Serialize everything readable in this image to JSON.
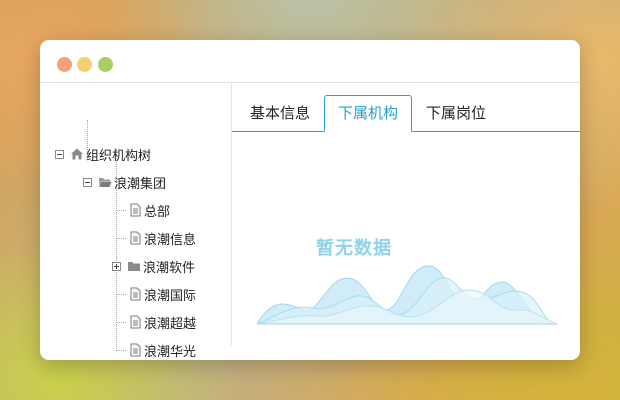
{
  "window": {
    "controls": [
      {
        "name": "close",
        "color": "#f4a17a"
      },
      {
        "name": "minimize",
        "color": "#f6cf72"
      },
      {
        "name": "maximize",
        "color": "#a8cf63"
      }
    ]
  },
  "tree": {
    "root": {
      "label": "组织机构树",
      "icon": "home-icon",
      "expanded": true
    },
    "group": {
      "label": "浪潮集团",
      "icon": "folder-open-icon",
      "expanded": true
    },
    "children": [
      {
        "label": "总部",
        "icon": "document-icon"
      },
      {
        "label": "浪潮信息",
        "icon": "document-icon"
      },
      {
        "label": "浪潮软件",
        "icon": "folder-icon",
        "expandable": true
      },
      {
        "label": "浪潮国际",
        "icon": "document-icon"
      },
      {
        "label": "浪潮超越",
        "icon": "document-icon"
      },
      {
        "label": "浪潮华光",
        "icon": "document-icon"
      }
    ]
  },
  "tabs": [
    {
      "label": "基本信息",
      "active": false
    },
    {
      "label": "下属机构",
      "active": true
    },
    {
      "label": "下属岗位",
      "active": false
    }
  ],
  "empty_state": {
    "text": "暂无数据",
    "icon": "wave-chart-illustration"
  },
  "colors": {
    "accent": "#2b9dd1",
    "empty_text": "#8fd2ea"
  }
}
